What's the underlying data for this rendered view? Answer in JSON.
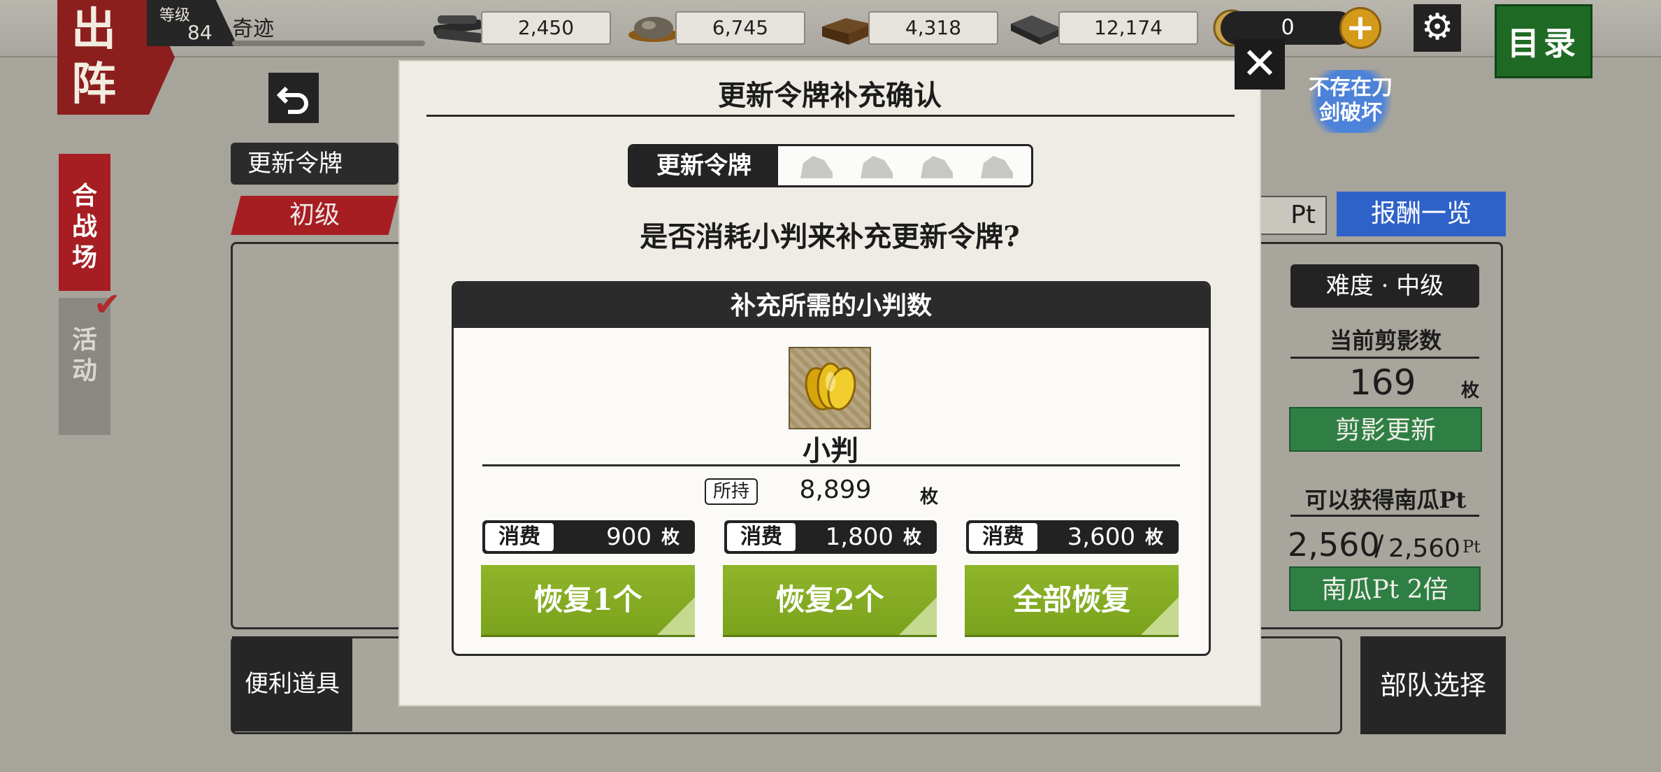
{
  "header": {
    "deploy_label": "出阵",
    "level_label": "等级",
    "level_value": "84",
    "player_name": "奇迹",
    "resources": [
      {
        "name": "charcoal",
        "icon": "charcoal-icon",
        "value": "2,450"
      },
      {
        "name": "steel",
        "icon": "steel-icon",
        "value": "6,745"
      },
      {
        "name": "cooling-material",
        "icon": "cooling-icon",
        "value": "4,318"
      },
      {
        "name": "whetstone",
        "icon": "whetstone-icon",
        "value": "12,174"
      }
    ],
    "koban_value": "0",
    "plus_glyph": "+",
    "menu_label": "目录",
    "gear_glyph": "⚙"
  },
  "side_tabs": [
    {
      "label": "合战场",
      "color": "#a61e22"
    },
    {
      "label": "活动",
      "color": "#7f7d78"
    }
  ],
  "background": {
    "token_label": "更新令牌",
    "difficulty_tab": "初级",
    "pt_suffix": "Pt",
    "reward_list": "报酬一览",
    "no_breakage": "不存在刀剑破坏",
    "right_panel": {
      "difficulty": "难度 · 中级",
      "shadow_label": "当前剪影数",
      "shadow_count": "169",
      "shadow_unit": "枚",
      "refresh_button": "剪影更新",
      "pumpkin_label": "可以获得南瓜Pt",
      "pumpkin_current": "2,560",
      "pumpkin_max": "2,560",
      "pumpkin_unit": "Pt",
      "double_button": "南瓜Pt 2倍"
    },
    "convenient_items": "便利道具",
    "team_select": "部队选择"
  },
  "modal": {
    "title": "更新令牌补充确认",
    "close_glyph": "✕",
    "token_label": "更新令牌",
    "token_slots": 4,
    "question": "是否消耗小判来补充更新令牌?",
    "box_title": "补充所需的小判数",
    "item_name": "小判",
    "held_label": "所持",
    "held_value": "8,899",
    "unit": "枚",
    "costs": [
      {
        "label": "消费",
        "value": "900",
        "unit": "枚",
        "button": "恢复1个"
      },
      {
        "label": "消费",
        "value": "1,800",
        "unit": "枚",
        "button": "恢复2个"
      },
      {
        "label": "消费",
        "value": "3,600",
        "unit": "枚",
        "button": "全部恢复"
      }
    ],
    "button_color": "#82aa20"
  }
}
